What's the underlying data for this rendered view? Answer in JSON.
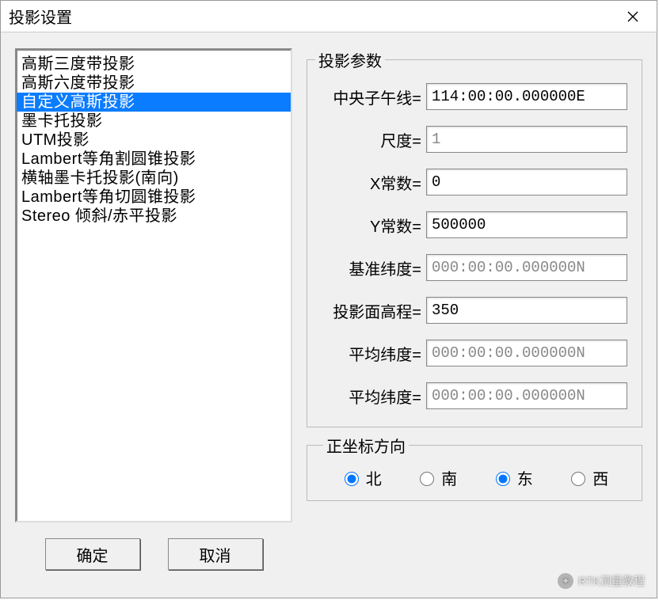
{
  "window": {
    "title": "投影设置"
  },
  "list": {
    "items": [
      "高斯三度带投影",
      "高斯六度带投影",
      "自定义高斯投影",
      "墨卡托投影",
      "UTM投影",
      "Lambert等角割圆锥投影",
      "横轴墨卡托投影(南向)",
      "Lambert等角切圆锥投影",
      "Stereo 倾斜/赤平投影"
    ],
    "selected_index": 2
  },
  "buttons": {
    "ok": "确定",
    "cancel": "取消"
  },
  "params": {
    "legend": "投影参数",
    "rows": [
      {
        "label": "中央子午线=",
        "value": "114:00:00.000000E",
        "readonly": false
      },
      {
        "label": "尺度=",
        "value": "1",
        "readonly": true
      },
      {
        "label": "X常数=",
        "value": "0",
        "readonly": false
      },
      {
        "label": "Y常数=",
        "value": "500000",
        "readonly": false
      },
      {
        "label": "基准纬度=",
        "value": "000:00:00.000000N",
        "readonly": true
      },
      {
        "label": "投影面高程=",
        "value": "350",
        "readonly": false
      },
      {
        "label": "平均纬度=",
        "value": "000:00:00.000000N",
        "readonly": true
      },
      {
        "label": "平均纬度=",
        "value": "000:00:00.000000N",
        "readonly": true
      }
    ]
  },
  "direction": {
    "legend": "正坐标方向",
    "options": [
      {
        "label": "北",
        "checked": true
      },
      {
        "label": "南",
        "checked": false
      },
      {
        "label": "东",
        "checked": true
      },
      {
        "label": "西",
        "checked": false
      }
    ]
  },
  "watermark": "RTK测量教程"
}
